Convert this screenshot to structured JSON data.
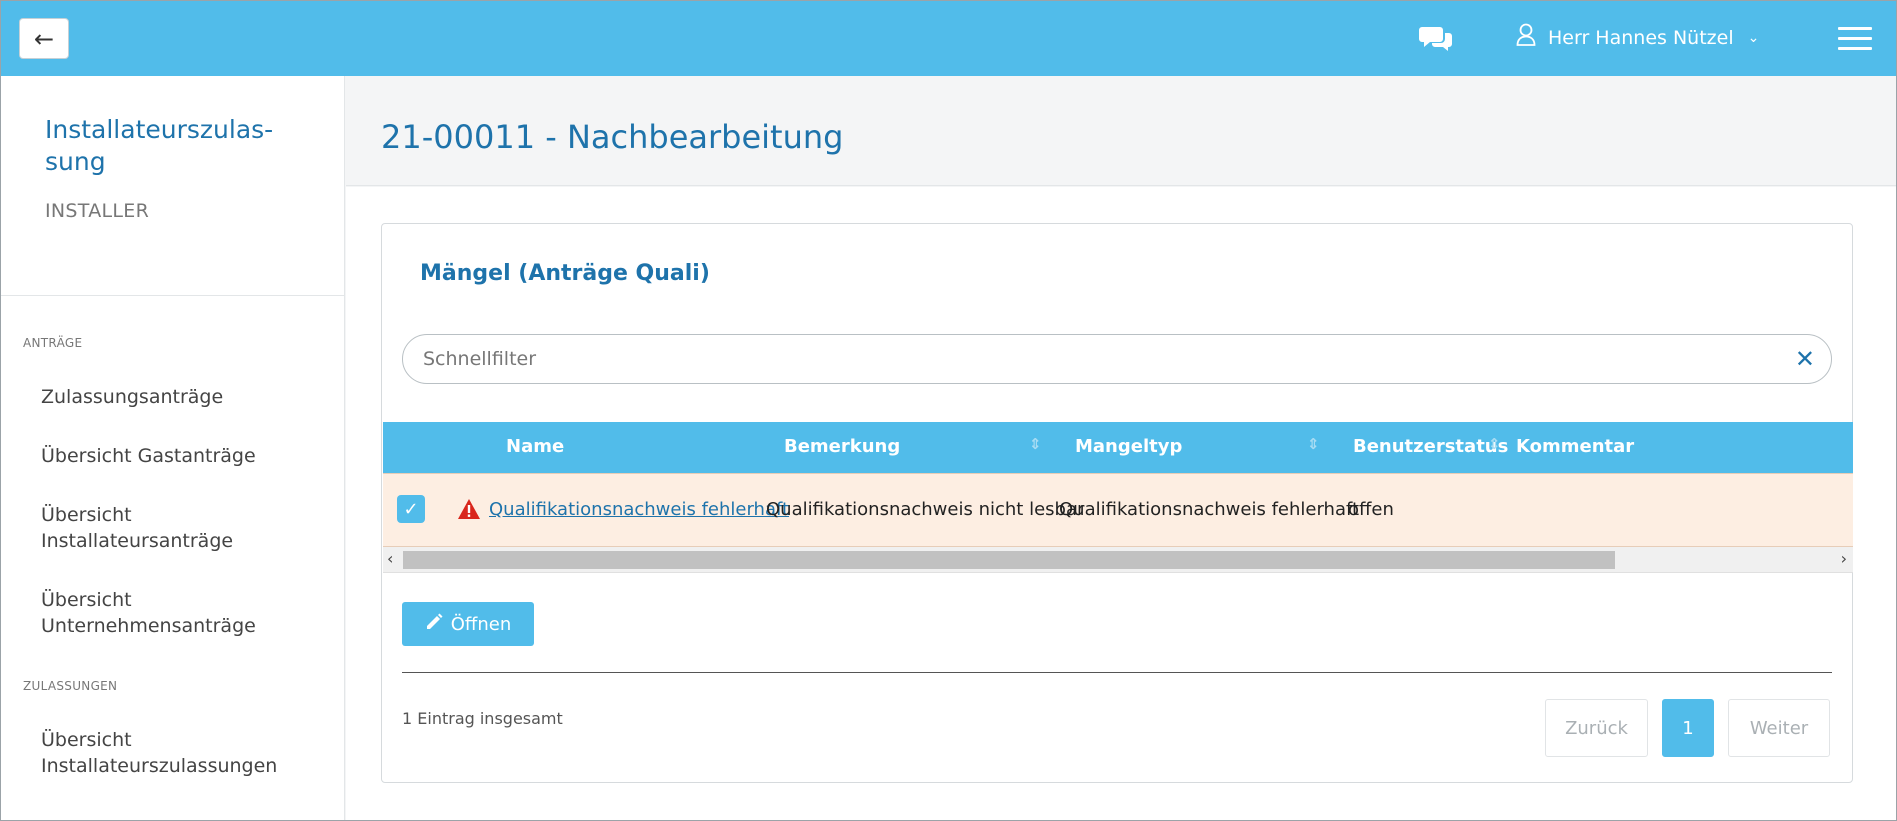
{
  "topbar": {
    "back_icon": "arrow-left-icon",
    "chat_icon": "chat-bubbles-icon",
    "user_icon": "user-icon",
    "user_name": "Herr Hannes Nützel",
    "menu_icon": "hamburger-menu-icon",
    "accent": "#51bcea"
  },
  "sidebar": {
    "title": "Installateurszulas-sung",
    "subtitle": "INSTALLER",
    "sections": [
      {
        "label": "ANTRÄGE",
        "items": [
          "Zulassungsanträge",
          "Übersicht Gastanträge",
          "Übersicht Installateursanträge",
          "Übersicht Unternehmensanträge"
        ]
      },
      {
        "label": "ZULASSUNGEN",
        "items": [
          "Übersicht Installateurszulassungen"
        ]
      }
    ]
  },
  "main": {
    "page_title": "21-00011 - Nachbearbeitung",
    "panel_title": "Mängel (Anträge Quali)",
    "filter": {
      "placeholder": "Schnellfilter",
      "value": "",
      "clear_icon": "close-icon"
    },
    "table": {
      "columns": [
        "Name",
        "Bemerkung",
        "Mangeltyp",
        "Benutzerstatus",
        "Kommentar"
      ],
      "rows": [
        {
          "checked": true,
          "status_icon": "warning-icon",
          "name": "Qualifikationsnachweis fehlerhaft",
          "bemerkung": "Qualifikationsnachweis nicht lesbar",
          "mangeltyp": "Qualifikationsnachweis fehlerhaft",
          "benutzerstatus": "offen",
          "kommentar": ""
        }
      ]
    },
    "open_button": {
      "label": "Öffnen",
      "icon": "pencil-icon"
    },
    "total_count": "1 Eintrag insgesamt",
    "pagination": {
      "prev": "Zurück",
      "current": "1",
      "next": "Weiter"
    }
  }
}
